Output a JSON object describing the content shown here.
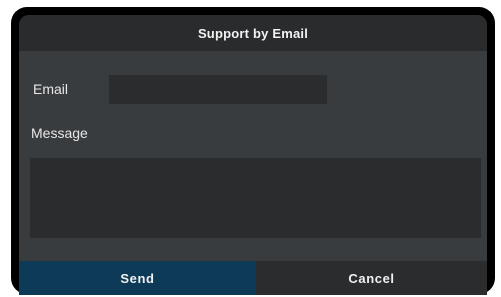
{
  "dialog": {
    "title": "Support by Email"
  },
  "form": {
    "email_label": "Email",
    "email_value": "",
    "message_label": "Message",
    "message_value": ""
  },
  "buttons": {
    "send_label": "Send",
    "cancel_label": "Cancel"
  },
  "colors": {
    "background": "#393c3f",
    "title_bar": "#2a2b2d",
    "field_background": "#2b2c2e",
    "send_button": "#0d3a56",
    "cancel_button": "#2b2c2e"
  }
}
